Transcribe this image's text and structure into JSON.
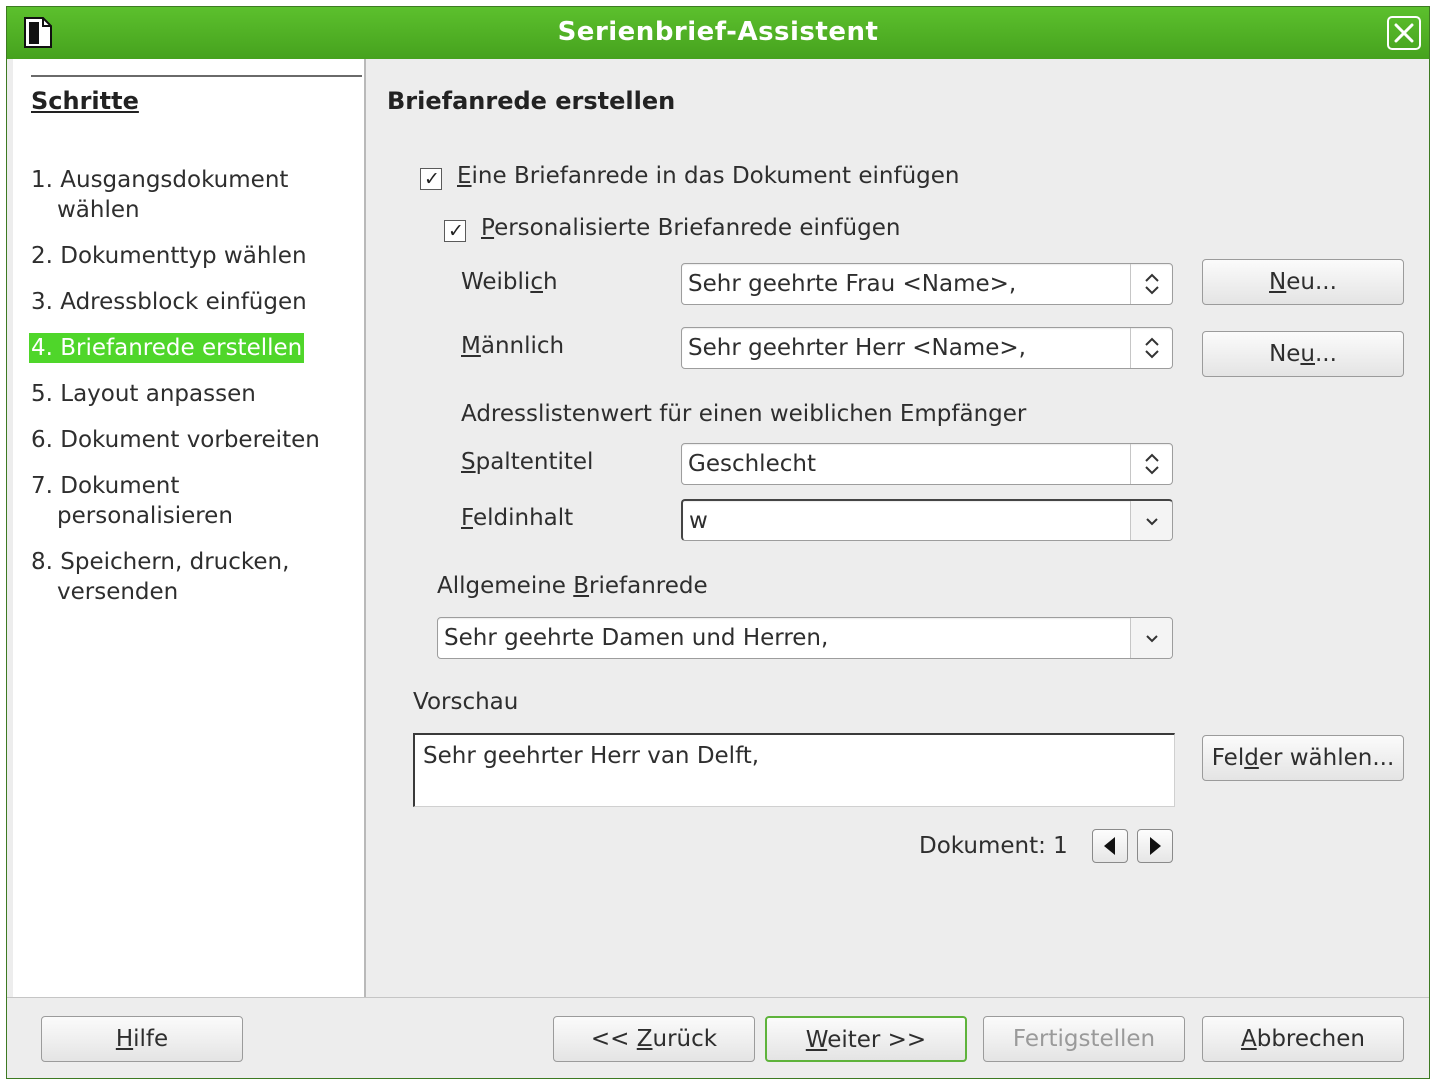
{
  "window": {
    "title": "Serienbrief-Assistent"
  },
  "sidebar": {
    "heading": "Schritte",
    "steps": [
      {
        "line1": "1. Ausgangsdokument",
        "line2": "wählen"
      },
      {
        "line1": "2. Dokumenttyp wählen"
      },
      {
        "line1": "3. Adressblock einfügen"
      },
      {
        "line1": "4. Briefanrede erstellen"
      },
      {
        "line1": "5. Layout anpassen"
      },
      {
        "line1": "6. Dokument vorbereiten"
      },
      {
        "line1": "7. Dokument",
        "line2": "personalisieren"
      },
      {
        "line1": "8. Speichern, drucken,",
        "line2": "versenden"
      }
    ],
    "active_index": 3
  },
  "content": {
    "title": "Briefanrede erstellen",
    "insert_salutation": {
      "pre": "",
      "accel": "E",
      "post": "ine Briefanrede in das Dokument einfügen",
      "checked": true
    },
    "personalized": {
      "pre": "",
      "accel": "P",
      "post": "ersonalisierte Briefanrede einfügen",
      "checked": true
    },
    "female": {
      "pre": "Weibli",
      "accel": "c",
      "post": "h",
      "value": "Sehr geehrte Frau <Name>,",
      "new_pre": "",
      "new_accel": "N",
      "new_post": "eu..."
    },
    "male": {
      "pre": "",
      "accel": "M",
      "post": "ännlich",
      "value": "Sehr geehrter Herr <Name>,",
      "new_pre": "Ne",
      "new_accel": "u",
      "new_post": "..."
    },
    "address_list_label": "Adresslistenwert für einen weiblichen Empfänger",
    "column_title": {
      "pre": "",
      "accel": "S",
      "post": "paltentitel",
      "value": "Geschlecht"
    },
    "field_content": {
      "pre": "",
      "accel": "F",
      "post": "eldinhalt",
      "value": "w"
    },
    "general_salutation": {
      "pre": "Allgemeine ",
      "accel": "B",
      "post": "riefanrede",
      "value": "Sehr geehrte Damen und Herren,"
    },
    "preview_label": "Vorschau",
    "preview_text": "Sehr geehrter Herr van Delft,",
    "select_fields": {
      "pre": "Fel",
      "accel": "d",
      "post": "er wählen..."
    },
    "document_label": "Dokument: 1"
  },
  "footer": {
    "help": {
      "pre": "",
      "accel": "H",
      "post": "ilfe"
    },
    "back": {
      "pre": "<< ",
      "accel": "Z",
      "post": "urück"
    },
    "next": {
      "pre": "",
      "accel": "W",
      "post": "eiter >>"
    },
    "finish": "Fertigstellen",
    "cancel": {
      "pre": "",
      "accel": "A",
      "post": "bbrechen"
    }
  },
  "colors": {
    "titlebar": "#4fb124",
    "active_step": "#4fd62a",
    "default_button_border": "#5eb33b"
  }
}
